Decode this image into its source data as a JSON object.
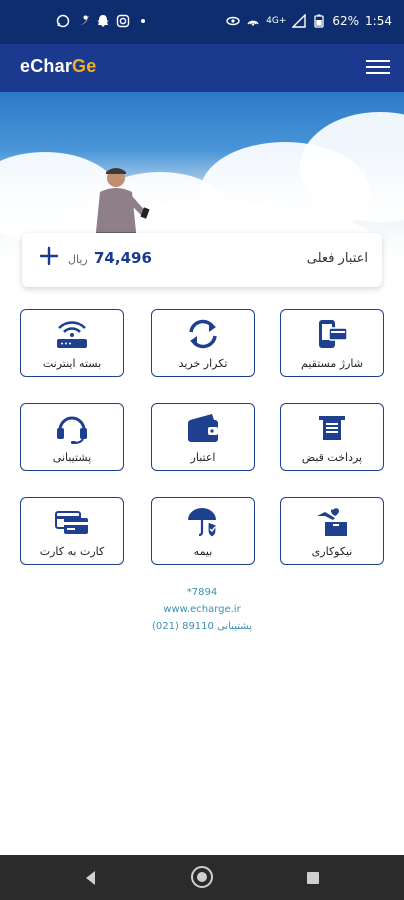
{
  "status_bar": {
    "time": "1:54",
    "battery": "62%",
    "network": "4G+",
    "left_icons": [
      "whatsapp-icon",
      "twitter-icon",
      "snapchat-icon",
      "instagram-icon",
      "dot-icon"
    ]
  },
  "app": {
    "logo_prefix": "eChar",
    "logo_accent": "Ge",
    "colors": {
      "header": "#1b3a8f",
      "status_bar": "#0e2d6e",
      "accent": "#f1b11c",
      "tile_border": "#1f3f8f",
      "footer_text": "#3c8fb2"
    }
  },
  "balance": {
    "label": "اعتبار فعلی",
    "amount": "74,496",
    "unit": "ریال"
  },
  "services": [
    {
      "label": "شارژ مستقیم",
      "icon": "phone-card-icon"
    },
    {
      "label": "تکرار خرید",
      "icon": "repeat-icon"
    },
    {
      "label": "بسته اینترنت",
      "icon": "wifi-router-icon"
    },
    {
      "label": "پرداخت قبض",
      "icon": "bill-icon"
    },
    {
      "label": "اعتبار",
      "icon": "wallet-icon"
    },
    {
      "label": "پشتیبانی",
      "icon": "headset-icon"
    },
    {
      "label": "نیکوکاری",
      "icon": "charity-box-icon"
    },
    {
      "label": "بیمه",
      "icon": "umbrella-shield-icon"
    },
    {
      "label": "کارت به کارت",
      "icon": "cards-icon"
    }
  ],
  "footer": {
    "ussd": "*7894",
    "website": "www.echarge.ir",
    "support": "پشتیبانی 89110 (021)"
  }
}
